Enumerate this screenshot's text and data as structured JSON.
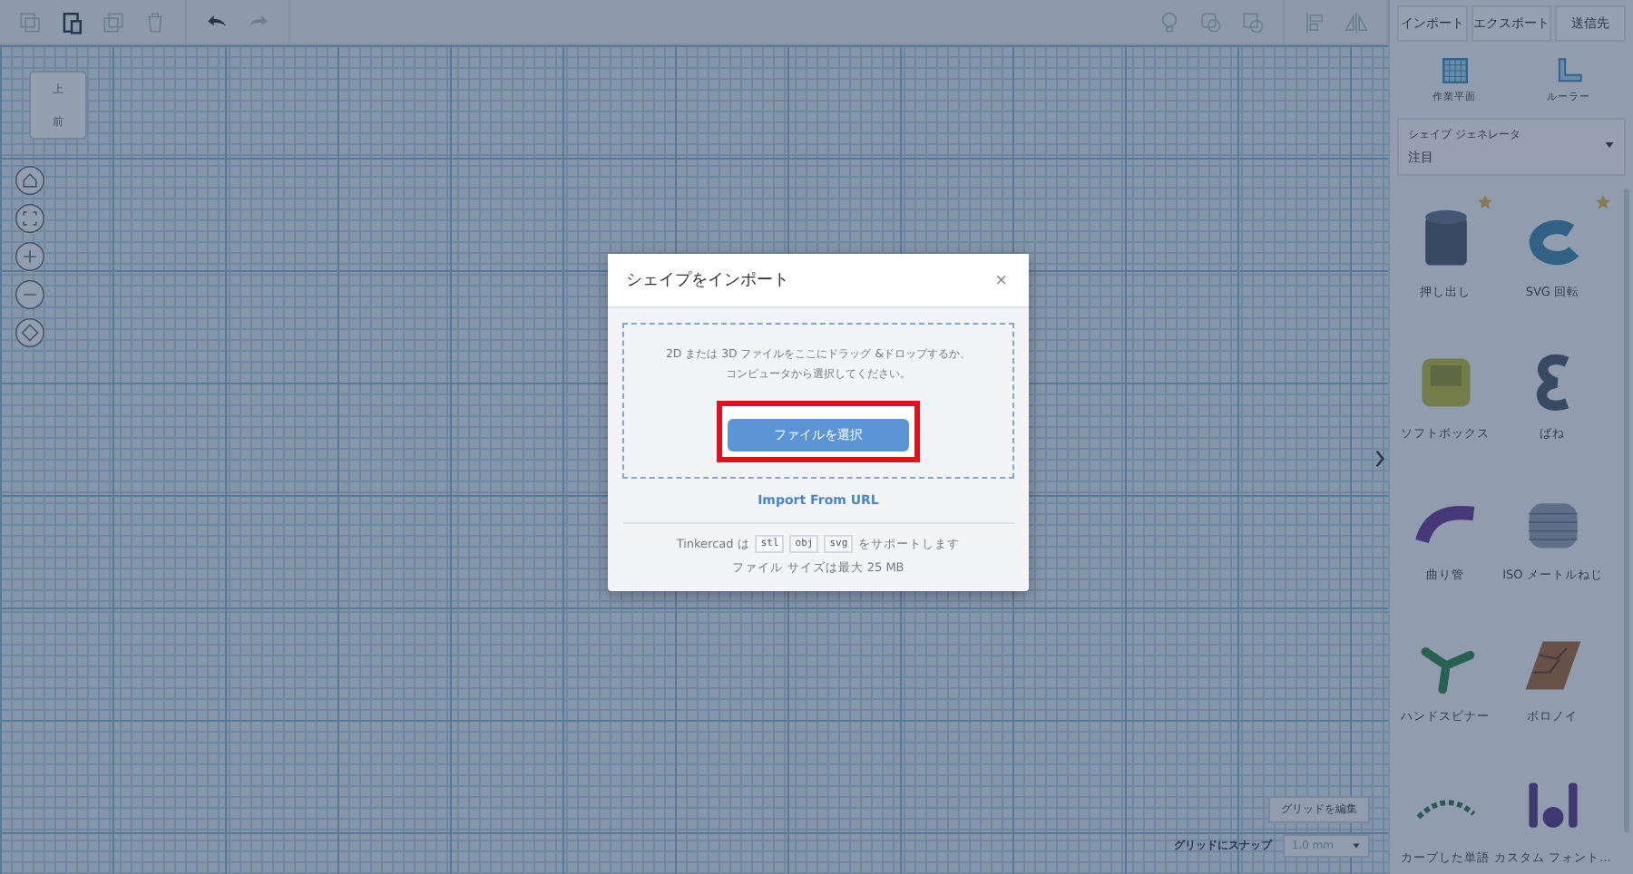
{
  "viewcube": {
    "top": "上",
    "front": "前"
  },
  "right_panel": {
    "tabs": [
      "インポート",
      "エクスポート",
      "送信先"
    ],
    "tools": [
      {
        "label": "作業平面",
        "kind": "workplane"
      },
      {
        "label": "ルーラー",
        "kind": "ruler"
      }
    ],
    "generator": {
      "label": "シェイプ ジェネレータ",
      "value": "注目"
    },
    "shapes": [
      {
        "name": "押し出し",
        "kind": "cylinder",
        "starred": true
      },
      {
        "name": "SVG 回転",
        "kind": "torus",
        "starred": true
      },
      {
        "name": "ソフトボックス",
        "kind": "box",
        "starred": false
      },
      {
        "name": "ばね",
        "kind": "spring",
        "starred": false
      },
      {
        "name": "曲り管",
        "kind": "pipe",
        "starred": false
      },
      {
        "name": "ISO メートルねじ",
        "kind": "screw",
        "starred": false
      },
      {
        "name": "ハンドスピナー",
        "kind": "spinner",
        "starred": false
      },
      {
        "name": "ボロノイ",
        "kind": "tile",
        "starred": false
      },
      {
        "name": "カーブした単語",
        "kind": "arc",
        "starred": false
      },
      {
        "name": "カスタム フォント…",
        "kind": "text",
        "starred": false
      }
    ]
  },
  "grid": {
    "edit_button": "グリッドを編集",
    "snap_label": "グリッドにスナップ",
    "snap_value": "1.0 mm"
  },
  "dialog": {
    "title": "シェイプをインポート",
    "close": "×",
    "drop_text": [
      "2D または 3D ファイルをここにドラッグ &ドロップするか、",
      "コンピュータから選択してください。"
    ],
    "choose_button": "ファイルを選択",
    "highlighted": true,
    "url_link": "Import From URL",
    "support_prefix": "Tinkercad は",
    "formats": [
      "stl",
      "obj",
      "svg"
    ],
    "support_suffix": "をサポートします",
    "size_note": "ファイル サイズは最大 25 MB"
  }
}
